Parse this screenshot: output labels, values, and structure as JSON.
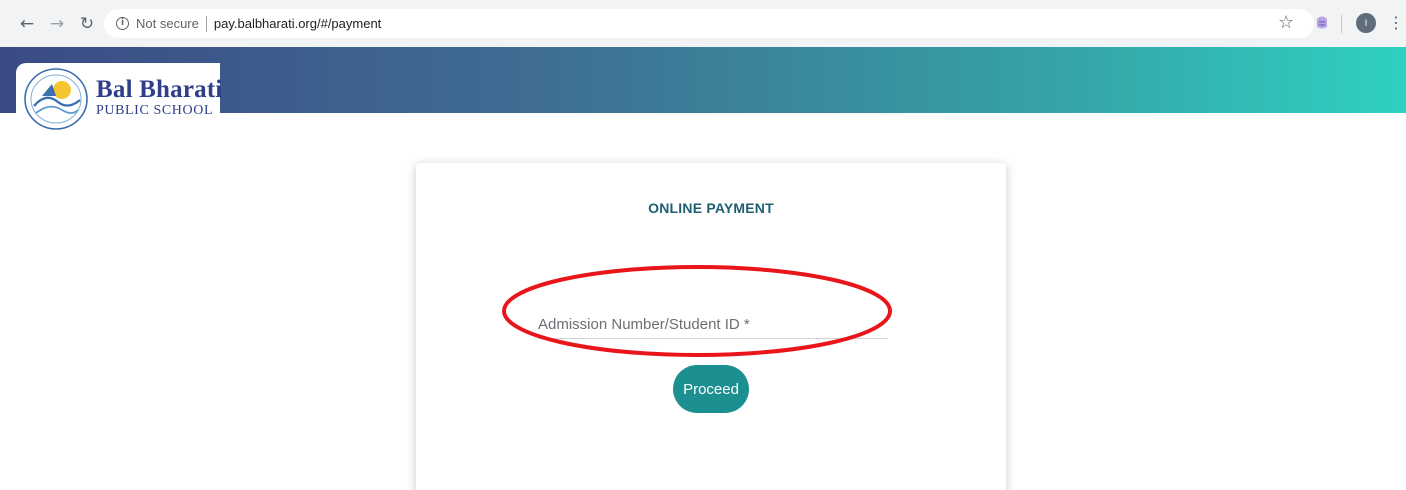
{
  "browser": {
    "security_label": "Not secure",
    "url": "pay.balbharati.org/#/payment",
    "profile_initial": "I"
  },
  "header": {
    "school_name": "Bal Bharati",
    "school_subtitle": "PUBLIC SCHOOL",
    "gradient_colors": [
      "#3b4a85",
      "#2fd0c2"
    ]
  },
  "payment": {
    "title": "ONLINE PAYMENT",
    "id_placeholder": "Admission Number/Student ID *",
    "proceed_label": "Proceed"
  },
  "colors": {
    "accent": "#1c8f91",
    "title": "#1f5f72",
    "annotation": "#e8161b"
  },
  "icons": {
    "back": "back-arrow-icon",
    "forward": "forward-arrow-icon",
    "reload": "reload-icon",
    "info": "info-icon",
    "bookmark": "star-icon",
    "extension": "extension-icon",
    "menu": "kebab-menu-icon"
  }
}
